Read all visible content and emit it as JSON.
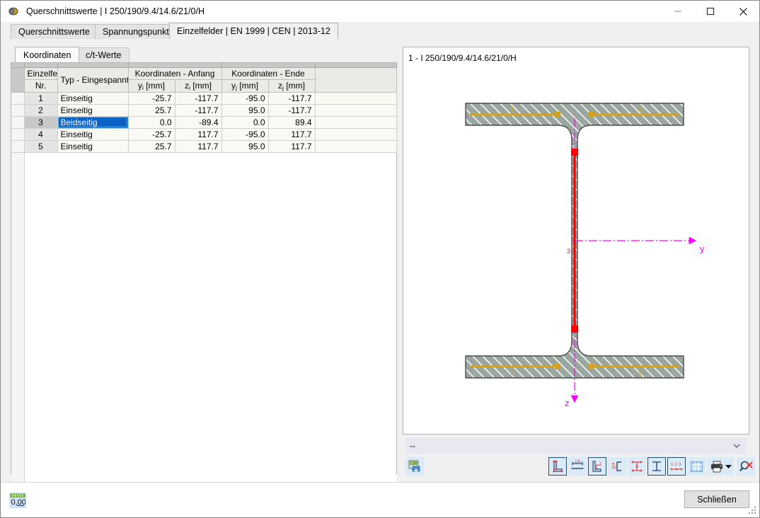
{
  "window": {
    "title": "Querschnittswerte | I 250/190/9.4/14.6/21/0/H",
    "app_icon": "section-properties-icon",
    "minimize_label": "—",
    "maximize_label": "□",
    "close_label": "✕"
  },
  "tabs": [
    {
      "label": "Querschnittswerte",
      "active": false
    },
    {
      "label": "Spannungspunkte",
      "active": false
    },
    {
      "label": "Einzelfelder | EN 1999 | CEN | 2013-12",
      "active": true
    }
  ],
  "subtabs": [
    {
      "label": "Koordinaten",
      "active": true
    },
    {
      "label": "c/t-Werte",
      "active": false
    }
  ],
  "table": {
    "group_headers": [
      {
        "label": "",
        "span": 1
      },
      {
        "label": "",
        "span": 1
      },
      {
        "label": "Koordinaten - Anfang",
        "span": 2
      },
      {
        "label": "Koordinaten - Ende",
        "span": 2
      },
      {
        "label": "",
        "span": 1
      }
    ],
    "headers_line1": [
      "Einzelfeld",
      "",
      "",
      "",
      "",
      "",
      ""
    ],
    "headers_line2": [
      "Nr.",
      "Typ - Eingespannt",
      "y",
      "z",
      "y",
      "z",
      ""
    ],
    "unit_y_i": "[mm]",
    "unit_z_i": "[mm]",
    "unit_y_j": "[mm]",
    "unit_z_j": "[mm]",
    "sub_i": "i",
    "sub_j": "j",
    "rows": [
      {
        "nr": "1",
        "typ": "Einseitig",
        "yi": "-25.7",
        "zi": "-117.7",
        "yj": "-95.0",
        "zj": "-117.7",
        "selected": false
      },
      {
        "nr": "2",
        "typ": "Einseitig",
        "yi": "25.7",
        "zi": "-117.7",
        "yj": "95.0",
        "zj": "-117.7",
        "selected": false
      },
      {
        "nr": "3",
        "typ": "Beidseitig",
        "yi": "0.0",
        "zi": "-89.4",
        "yj": "0.0",
        "zj": "89.4",
        "selected": true
      },
      {
        "nr": "4",
        "typ": "Einseitig",
        "yi": "-25.7",
        "zi": "117.7",
        "yj": "-95.0",
        "zj": "117.7",
        "selected": false
      },
      {
        "nr": "5",
        "typ": "Einseitig",
        "yi": "25.7",
        "zi": "117.7",
        "yj": "95.0",
        "zj": "117.7",
        "selected": false
      }
    ]
  },
  "drawing": {
    "title": "1 - I 250/190/9.4/14.6/21/0/H",
    "axis_y_label": "y",
    "axis_z_label": "z",
    "element_labels": [
      "1",
      "2",
      "3",
      "4",
      "5"
    ],
    "selected_element": "3",
    "colors": {
      "section_fill": "#9aa6a0",
      "section_outline": "#4a4a4a",
      "hatch": "#ffffff",
      "element_line": "#d6a21c",
      "selected_line": "#ff0000",
      "axis": "#ff00ff"
    }
  },
  "combo": {
    "value": "--",
    "arrow_icon": "chevron-down-icon"
  },
  "toolbar": {
    "snapshot_icon": "picture-export-icon",
    "buttons": [
      {
        "name": "show-parts-icon",
        "framed": true
      },
      {
        "name": "dimensions-icon",
        "framed": false
      },
      {
        "name": "axes-icon",
        "framed": true
      },
      {
        "name": "shear-center-icon",
        "framed": false
      },
      {
        "name": "stress-points-icon",
        "framed": false
      },
      {
        "name": "section-outline-icon",
        "framed": true
      },
      {
        "name": "numbering-icon",
        "framed": true
      },
      {
        "name": "grid-icon",
        "framed": false
      },
      {
        "name": "print-icon",
        "framed": false
      },
      {
        "name": "zoom-reset-icon",
        "framed": false
      }
    ],
    "print_dropdown_icon": "caret-down-icon"
  },
  "statusbar": {
    "unit_icon_label": "0,00",
    "unit_icon_name": "decimal-places-icon",
    "close_button": "Schließen",
    "resize_grip": "resize-grip-icon"
  }
}
